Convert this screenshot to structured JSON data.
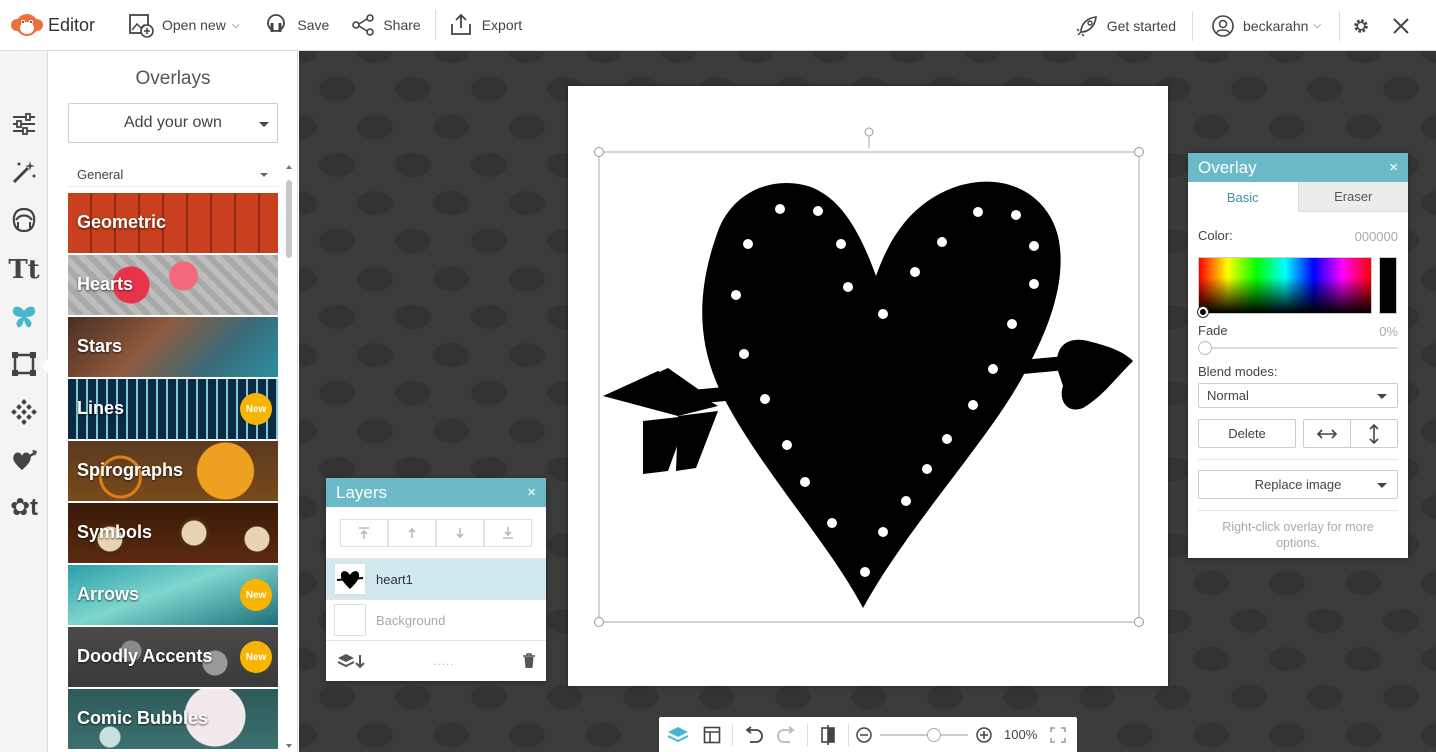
{
  "topbar": {
    "brand": "Editor",
    "open_new": "Open new",
    "save": "Save",
    "share": "Share",
    "export": "Export",
    "get_started": "Get started",
    "username": "beckarahn"
  },
  "panel": {
    "title": "Overlays",
    "add_own": "Add your own",
    "category": "General",
    "tiles": [
      {
        "label": "Geometric",
        "new": ""
      },
      {
        "label": "Hearts",
        "new": ""
      },
      {
        "label": "Stars",
        "new": ""
      },
      {
        "label": "Lines",
        "new": "New"
      },
      {
        "label": "Spirographs",
        "new": ""
      },
      {
        "label": "Symbols",
        "new": ""
      },
      {
        "label": "Arrows",
        "new": "New"
      },
      {
        "label": "Doodly Accents",
        "new": "New"
      },
      {
        "label": "Comic Bubbles",
        "new": ""
      }
    ]
  },
  "layers": {
    "title": "Layers",
    "close": "×",
    "items": [
      {
        "name": "heart1"
      },
      {
        "name": "Background"
      }
    ],
    "footer_dots": "....."
  },
  "overlay": {
    "title": "Overlay",
    "close": "×",
    "tab_basic": "Basic",
    "tab_eraser": "Eraser",
    "color_label": "Color:",
    "color_value": "000000",
    "fade_label": "Fade",
    "fade_value": "0%",
    "blend_label": "Blend modes:",
    "blend_value": "Normal",
    "delete": "Delete",
    "replace": "Replace image",
    "hint": "Right-click overlay for more options."
  },
  "bottombar": {
    "zoom": "100%"
  },
  "colors": {
    "accent": "#6cbac8",
    "brand": "#ef6f3c",
    "workspace": "#3a3a3a",
    "badge": "#f7b500"
  }
}
